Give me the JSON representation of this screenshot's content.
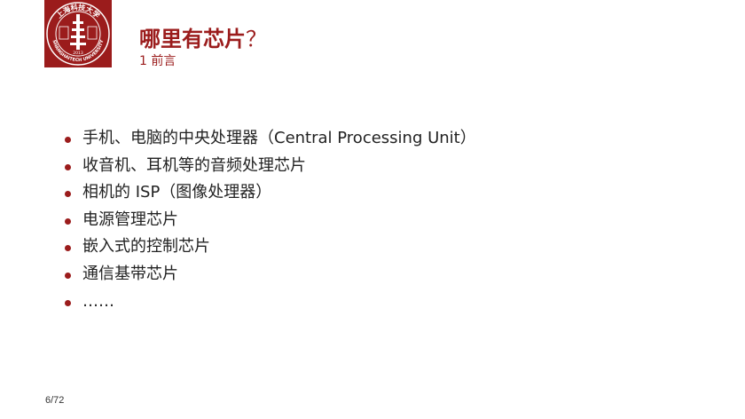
{
  "colors": {
    "accent": "#9b1c1c",
    "text": "#222222",
    "logo_bg": "#9b1c1c"
  },
  "logo": {
    "icon": "shanghaitech-university-seal-icon",
    "top_text": "上海科技大学",
    "bottom_text": "SHANGHAITECH UNIVERSITY",
    "year": "2013",
    "motto": "立志 成才 报国 裕民"
  },
  "header": {
    "title": "哪里有芯片",
    "title_suffix": "？",
    "subtitle": "1 前言"
  },
  "bullets": [
    "手机、电脑的中央处理器（Central Processing Unit）",
    "收音机、耳机等的音频处理芯片",
    "相机的 ISP（图像处理器）",
    "电源管理芯片",
    "嵌入式的控制芯片",
    "通信基带芯片",
    "……"
  ],
  "footer": {
    "page_number": "6/72"
  }
}
